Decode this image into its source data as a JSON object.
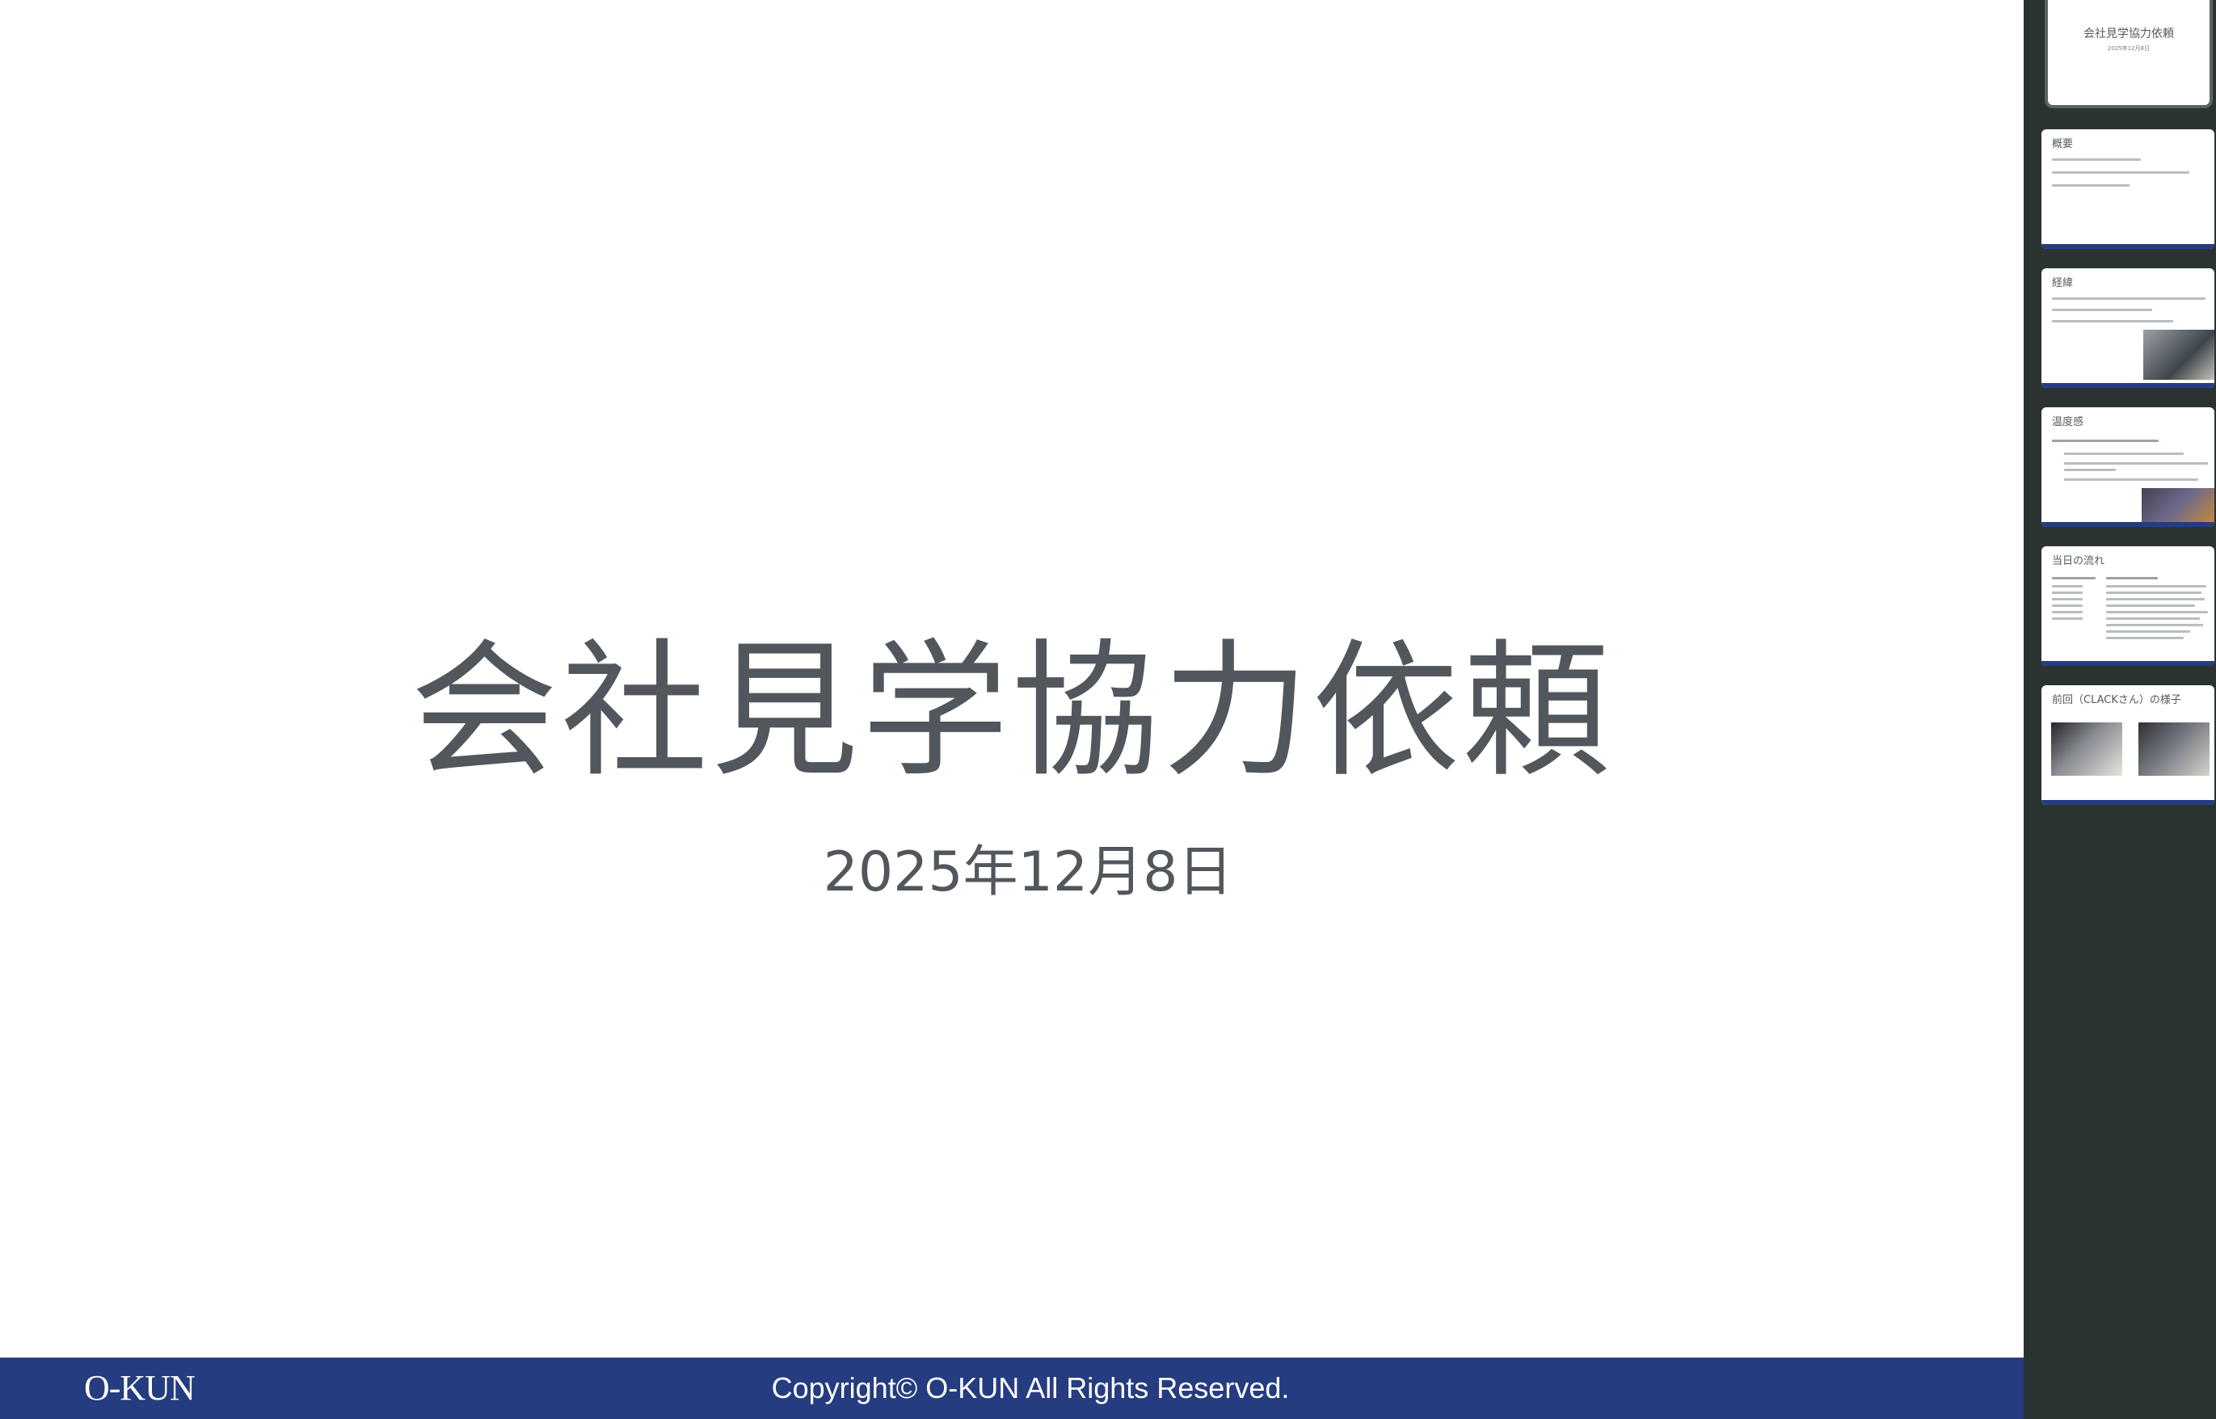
{
  "slide": {
    "title": "会社見学協力依頼",
    "date": "2025年12月8日",
    "footer_logo": "O-KUN",
    "footer_copyright": "Copyright© O-KUN All Rights Reserved."
  },
  "thumbnails": [
    {
      "title": "会社見学協力依頼",
      "date": "2025年12月8日",
      "selected": true
    },
    {
      "title": "概要"
    },
    {
      "title": "経緯"
    },
    {
      "title": "温度感"
    },
    {
      "title": "当日の流れ"
    },
    {
      "title": "前回（CLACKさん）の様子"
    }
  ],
  "colors": {
    "footer": "#253c80",
    "text": "#52575d",
    "panel": "#2b3232"
  }
}
